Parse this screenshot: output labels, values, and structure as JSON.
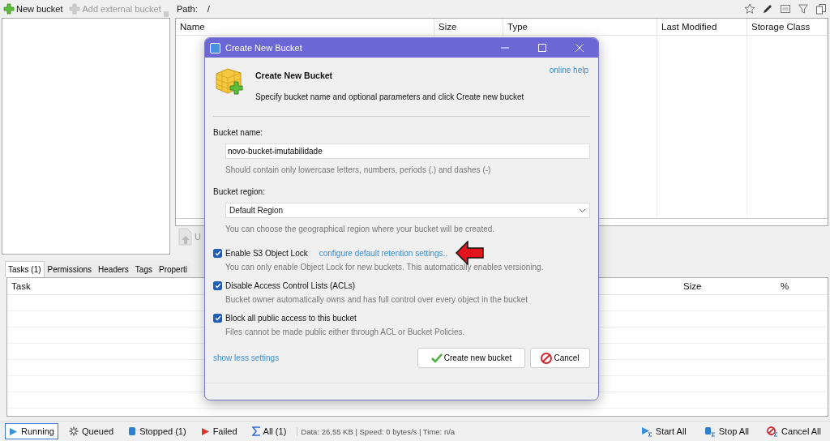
{
  "toolbar": {
    "buttons": [
      {
        "label": "New bucket",
        "disabled": false
      },
      {
        "label": "Add external bucket",
        "disabled": true
      }
    ]
  },
  "path": {
    "label": "Path:",
    "value": "/"
  },
  "file_table": {
    "columns": [
      "Name",
      "Size",
      "Type",
      "Last Modified",
      "Storage Class"
    ]
  },
  "upload_button": {
    "label": "U"
  },
  "bottom_tabs": [
    {
      "label": "Tasks (1)",
      "selected": true
    },
    {
      "label": "Permissions",
      "selected": false
    },
    {
      "label": "Headers",
      "selected": false
    },
    {
      "label": "Tags",
      "selected": false
    },
    {
      "label": "Properti",
      "selected": false
    }
  ],
  "tasks_table": {
    "columns": [
      "Task",
      "Size",
      "%"
    ]
  },
  "dialog": {
    "title": "Create New Bucket",
    "heading": "Create New Bucket",
    "description": "Specify bucket name and optional parameters and click Create new bucket",
    "help_link": "online help",
    "bucket_name": {
      "label": "Bucket name:",
      "value": "novo-bucket-imutabilidade",
      "hint": "Should contain only lowercase letters, numbers, periods (.) and dashes (-)"
    },
    "region": {
      "label": "Bucket region:",
      "value": "Default Region",
      "hint": "You can choose the geographical region where your bucket will be created."
    },
    "options": [
      {
        "label": "Enable S3 Object Lock",
        "checked": true,
        "link": "configure default retention settings..",
        "hint": "You can only enable Object Lock for new buckets. This automatically enables versioning."
      },
      {
        "label": "Disable Access Control Lists (ACLs)",
        "checked": true,
        "hint": "Bucket owner automatically owns and has full control over every object in the bucket"
      },
      {
        "label": "Block all public access to this bucket",
        "checked": true,
        "hint": "Files cannot be made public either through ACL or Bucket Policies."
      }
    ],
    "show_less_link": "show less settings",
    "buttons": [
      {
        "kind": "create",
        "label": "Create new bucket"
      },
      {
        "kind": "cancel",
        "label": "Cancel"
      }
    ]
  },
  "status_bar": {
    "filters": [
      {
        "kind": "running",
        "label": "Running",
        "selected": true
      },
      {
        "kind": "queued",
        "label": "Queued",
        "selected": false
      },
      {
        "kind": "stopped",
        "label": "Stopped (1)",
        "selected": false
      },
      {
        "kind": "failed",
        "label": "Failed",
        "selected": false
      },
      {
        "kind": "all",
        "label": "All (1)",
        "selected": false
      }
    ],
    "info": "Data: 26,55 KB | Speed: 0 bytes/s | Time: n/a",
    "actions": [
      {
        "kind": "start",
        "label": "Start All"
      },
      {
        "kind": "stop",
        "label": "Stop All"
      },
      {
        "kind": "cancel",
        "label": "Cancel All"
      }
    ]
  }
}
